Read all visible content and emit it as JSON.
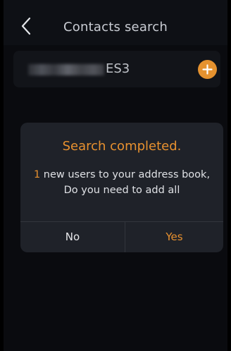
{
  "header": {
    "title": "Contacts search",
    "back_icon": "chevron-left-icon"
  },
  "contact": {
    "name_visible_suffix": "ES3",
    "add_icon": "plus-icon"
  },
  "dialog": {
    "title": "Search completed.",
    "count": "1",
    "message_line1": " new users to your address book,",
    "message_line2": "Do you need to add all",
    "no_label": "No",
    "yes_label": "Yes"
  },
  "colors": {
    "accent": "#e8912f",
    "background": "#0a0b0f",
    "dialog_background": "#1f2229"
  }
}
